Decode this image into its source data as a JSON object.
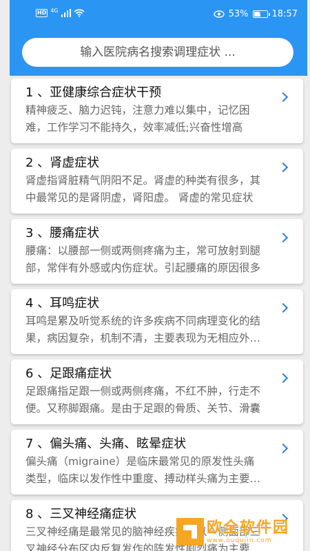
{
  "status_bar": {
    "hd": "HD",
    "net_type": "4G",
    "battery_percent": "53%",
    "battery_level": 0.53,
    "time": "18:57",
    "icons": [
      "hd-badge",
      "signal-icon",
      "wifi-icon",
      "eye-icon",
      "battery-icon"
    ]
  },
  "search": {
    "placeholder": "输入医院病名搜索调理症状 ..."
  },
  "items": [
    {
      "title": "1 、亚健康综合症状干预",
      "desc": "精神疲乏、脑力迟钝，注意力难以集中，记忆困难，工作学习不能持久，效率减低;兴奋性增高"
    },
    {
      "title": "2 、肾虚症状",
      "desc": "肾虚指肾脏精气阴阳不足。肾虚的种类有很多，其中最常见的是肾阴虚，肾阳虚。 肾虚的常见症状"
    },
    {
      "title": "3 、腰痛症状",
      "desc": "腰痛：以腰部一侧或两侧疼痛为主，常可放射到腿部，常伴有外感或内伤症状。引起腰痛的原因很多"
    },
    {
      "title": "4 、耳鸣症状",
      "desc": "耳鸣是累及听觉系统的许多疾病不同病理变化的结果，病因复杂，机制不清，主要表现为无相应外界声源"
    },
    {
      "title": "6 、足跟痛症状",
      "desc": "足跟痛指足跟一侧或两侧疼痛，不红不肿，行走不便。又称脚跟痛。是由于足跟的骨质、关节、滑囊"
    },
    {
      "title": "7 、偏头痛、头痛、眩晕症状",
      "desc": "偏头痛（migraine）是临床最常见的原发性头痛类型，临床以发作性中重度、搏动样头痛为主要表现"
    },
    {
      "title": "8 、三叉神经痛症状",
      "desc": "三叉神经痛是最常见的脑神经疾病，以一侧面部三叉神经分布区内反复发作的阵发性剧烈痛为主要表现"
    }
  ],
  "watermark": {
    "title": "欧全软件园",
    "url": "www.ouqujin.com"
  },
  "colors": {
    "header": "#2a95f3",
    "chevron": "#2a7fd8",
    "watermark": "#f5a623"
  }
}
